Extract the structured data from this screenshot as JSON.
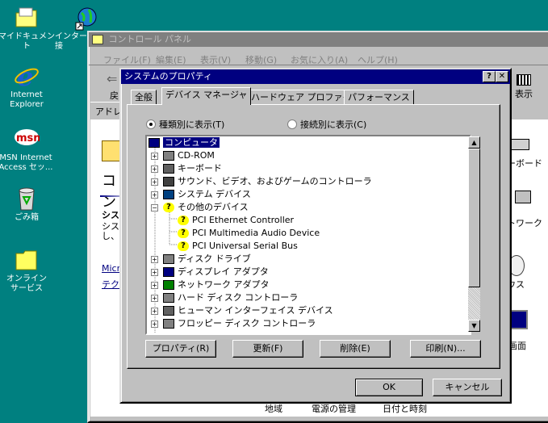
{
  "desktop": {
    "icons": [
      {
        "label": "マイドキュメント"
      },
      {
        "label": "インター 接"
      },
      {
        "label": "Internet Explorer"
      },
      {
        "label": "MSN Internet Access セッ..."
      },
      {
        "label": "ごみ箱"
      },
      {
        "label": "オンライン サービス"
      }
    ]
  },
  "control_panel": {
    "title": "コントロール パネル",
    "menu": [
      "ファイル(F)",
      "編集(E)",
      "表示(V)",
      "移動(G)",
      "お気に入り(A)",
      "ヘルプ(H)"
    ],
    "toolbar_back": "戻",
    "toolbar_view": "表示",
    "address_label": "アドレ",
    "left_heading": "コン",
    "left_sub_heading": "シス",
    "left_text1": "シス",
    "left_text2": "し、言",
    "link1": "Micr",
    "link2": "テク",
    "right_items": [
      "ーボード",
      "トワーク",
      "ウス",
      "画面"
    ],
    "bottom_items": [
      "地域",
      "電源の管理",
      "日付と時刻"
    ]
  },
  "dialog": {
    "title": "システムのプロパティ",
    "help_btn": "?",
    "close_btn": "✕",
    "tabs": [
      "全般",
      "デバイス マネージャ",
      "ハードウェア プロファイル",
      "パフォーマンス"
    ],
    "radio_by_type": "種類別に表示(T)",
    "radio_by_connection": "接続別に表示(C)",
    "tree": [
      {
        "label": "コンピュータ",
        "level": 0,
        "expander": "",
        "icon": "computer-icon"
      },
      {
        "label": "CD-ROM",
        "level": 1,
        "expander": "+",
        "icon": "cdrom-icon"
      },
      {
        "label": "キーボード",
        "level": 1,
        "expander": "+",
        "icon": "keyboard-icon"
      },
      {
        "label": "サウンド、ビデオ、およびゲームのコントローラ",
        "level": 1,
        "expander": "+",
        "icon": "sound-icon"
      },
      {
        "label": "システム デバイス",
        "level": 1,
        "expander": "+",
        "icon": "system-device-icon"
      },
      {
        "label": "その他のデバイス",
        "level": 1,
        "expander": "−",
        "icon": "unknown-device-icon"
      },
      {
        "label": "PCI Ethernet Controller",
        "level": 2,
        "expander": "",
        "icon": "unknown-device-icon"
      },
      {
        "label": "PCI Multimedia Audio Device",
        "level": 2,
        "expander": "",
        "icon": "unknown-device-icon"
      },
      {
        "label": "PCI Universal Serial Bus",
        "level": 2,
        "expander": "",
        "icon": "unknown-device-icon"
      },
      {
        "label": "ディスク ドライブ",
        "level": 1,
        "expander": "+",
        "icon": "disk-drive-icon"
      },
      {
        "label": "ディスプレイ アダプタ",
        "level": 1,
        "expander": "+",
        "icon": "display-adapter-icon"
      },
      {
        "label": "ネットワーク アダプタ",
        "level": 1,
        "expander": "+",
        "icon": "network-adapter-icon"
      },
      {
        "label": "ハード ディスク コントローラ",
        "level": 1,
        "expander": "+",
        "icon": "hdd-controller-icon"
      },
      {
        "label": "ヒューマン インターフェイス デバイス",
        "level": 1,
        "expander": "+",
        "icon": "hid-icon"
      },
      {
        "label": "フロッピー ディスク コントローラ",
        "level": 1,
        "expander": "+",
        "icon": "floppy-controller-icon"
      }
    ],
    "buttons": {
      "properties": "プロパティ(R)",
      "refresh": "更新(F)",
      "remove": "削除(E)",
      "print": "印刷(N)..."
    },
    "ok": "OK",
    "cancel": "キャンセル"
  },
  "colors": {
    "desktop": "#008080",
    "title_active": "#000080",
    "title_inactive": "#808080",
    "face": "#c0c0c0"
  }
}
